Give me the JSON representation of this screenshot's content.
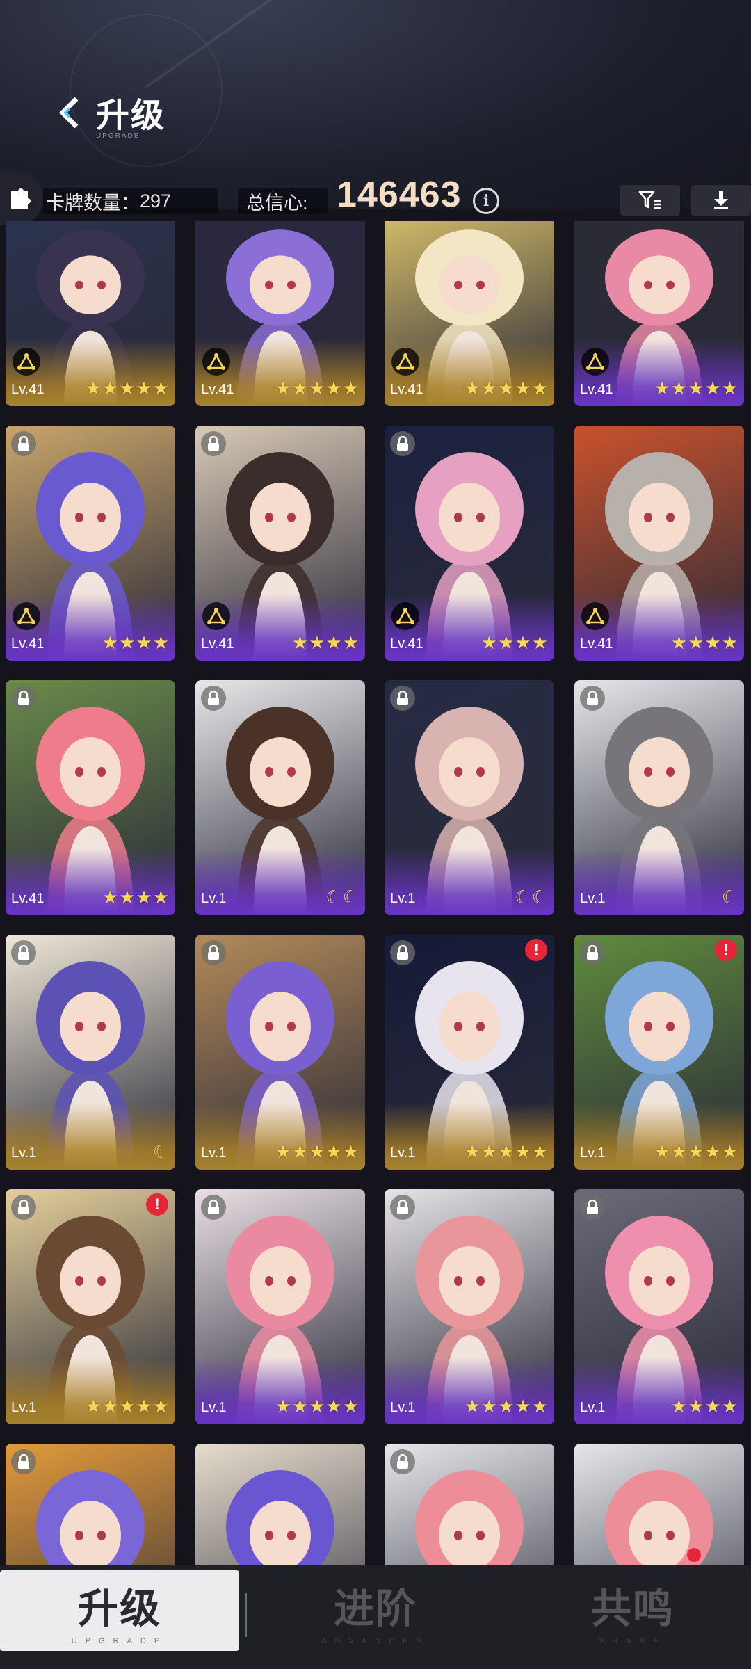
{
  "header": {
    "title": "升级",
    "subtitle": "UPGRADE",
    "card_count_label": "卡牌数量：",
    "card_count": "297",
    "trust_label": "总信心:",
    "trust_value": "146463"
  },
  "cards": [
    {
      "level": "Lv.41",
      "rank": "★★★★★",
      "frame": "gold",
      "skill": true,
      "lock": false,
      "alert": false,
      "hair": "#3a3350",
      "bg": "#2b3350"
    },
    {
      "level": "Lv.41",
      "rank": "★★★★★",
      "frame": "gold",
      "skill": true,
      "lock": false,
      "alert": false,
      "hair": "#8b6fd6",
      "bg": "#2a2740"
    },
    {
      "level": "Lv.41",
      "rank": "★★★★★",
      "frame": "gold",
      "skill": true,
      "lock": false,
      "alert": false,
      "hair": "#f3e6c4",
      "bg": "#d8c06a"
    },
    {
      "level": "Lv.41",
      "rank": "★★★★★",
      "frame": "purple",
      "skill": true,
      "lock": false,
      "alert": false,
      "hair": "#e88aa6",
      "bg": "#2b2b36"
    },
    {
      "level": "Lv.41",
      "rank": "★★★★",
      "frame": "purple",
      "skill": true,
      "lock": true,
      "alert": false,
      "hair": "#6a5ad0",
      "bg": "#c9a56b"
    },
    {
      "level": "Lv.41",
      "rank": "★★★★",
      "frame": "purple",
      "skill": true,
      "lock": true,
      "alert": false,
      "hair": "#3b2d2b",
      "bg": "#d8c9b6"
    },
    {
      "level": "Lv.41",
      "rank": "★★★★",
      "frame": "purple",
      "skill": true,
      "lock": true,
      "alert": false,
      "hair": "#e6a0c2",
      "bg": "#1b2140"
    },
    {
      "level": "Lv.41",
      "rank": "★★★★",
      "frame": "purple",
      "skill": true,
      "lock": false,
      "alert": false,
      "hair": "#b8b0aa",
      "bg": "#c9522c"
    },
    {
      "level": "Lv.41",
      "rank": "★★★★",
      "frame": "purple",
      "skill": false,
      "lock": true,
      "alert": false,
      "hair": "#ee7c8a",
      "bg": "#6a8a4a"
    },
    {
      "level": "Lv.1",
      "rank": "☾☾",
      "frame": "purple",
      "skill": false,
      "lock": true,
      "alert": false,
      "hair": "#4a3228",
      "bg": "#e8e8ea"
    },
    {
      "level": "Lv.1",
      "rank": "☾☾",
      "frame": "purple",
      "skill": false,
      "lock": true,
      "alert": false,
      "hair": "#d9b3b0",
      "bg": "#262b45"
    },
    {
      "level": "Lv.1",
      "rank": "☾",
      "frame": "purple",
      "skill": false,
      "lock": true,
      "alert": false,
      "hair": "#77757a",
      "bg": "#e6e6ea"
    },
    {
      "level": "Lv.1",
      "rank": "☾",
      "frame": "gold",
      "skill": false,
      "lock": true,
      "alert": false,
      "hair": "#5c52b5",
      "bg": "#efe7d6"
    },
    {
      "level": "Lv.1",
      "rank": "★★★★★",
      "frame": "gold",
      "skill": false,
      "lock": true,
      "alert": false,
      "hair": "#7a5fd0",
      "bg": "#b38a58"
    },
    {
      "level": "Lv.1",
      "rank": "★★★★★",
      "frame": "gold",
      "skill": false,
      "lock": true,
      "alert": true,
      "hair": "#e7e4ee",
      "bg": "#141a38"
    },
    {
      "level": "Lv.1",
      "rank": "★★★★★",
      "frame": "gold",
      "skill": false,
      "lock": true,
      "alert": true,
      "hair": "#7fa6d8",
      "bg": "#5f8b3c"
    },
    {
      "level": "Lv.1",
      "rank": "★★★★★",
      "frame": "gold",
      "skill": false,
      "lock": true,
      "alert": true,
      "hair": "#6a4a33",
      "bg": "#e4cf9a"
    },
    {
      "level": "Lv.1",
      "rank": "★★★★★",
      "frame": "purple",
      "skill": false,
      "lock": true,
      "alert": false,
      "hair": "#ea8aa0",
      "bg": "#e9dfe4"
    },
    {
      "level": "Lv.1",
      "rank": "★★★★★",
      "frame": "purple",
      "skill": false,
      "lock": true,
      "alert": false,
      "hair": "#e9969a",
      "bg": "#e6e3e6"
    },
    {
      "level": "Lv.1",
      "rank": "★★★★",
      "frame": "purple",
      "skill": false,
      "lock": true,
      "alert": false,
      "hair": "#ee8fae",
      "bg": "#6c6a78"
    },
    {
      "level": "",
      "rank": "",
      "frame": "none",
      "skill": false,
      "lock": true,
      "alert": false,
      "hair": "#7a66d6",
      "bg": "#e39a3a"
    },
    {
      "level": "",
      "rank": "",
      "frame": "none",
      "skill": false,
      "lock": false,
      "alert": false,
      "hair": "#6a56d0",
      "bg": "#e6dccd"
    },
    {
      "level": "",
      "rank": "",
      "frame": "none",
      "skill": false,
      "lock": true,
      "alert": false,
      "hair": "#ec8d98",
      "bg": "#e6e6ea"
    },
    {
      "level": "",
      "rank": "",
      "frame": "none",
      "skill": false,
      "lock": false,
      "alert": false,
      "hair": "#ec8d98",
      "bg": "#e6e6ea"
    }
  ],
  "tabs": [
    {
      "zh": "升级",
      "en": "UPGRADE",
      "active": true
    },
    {
      "zh": "进阶",
      "en": "ADVANCES",
      "active": false
    },
    {
      "zh": "共鸣",
      "en": "SHARE",
      "active": false
    }
  ],
  "colors": {
    "accent_gold": "#f6d75a",
    "trust_value": "#f5ddc4",
    "alert_red": "#e4263a",
    "frame_purple": "#6a34c6",
    "frame_gold": "#a4822e"
  }
}
